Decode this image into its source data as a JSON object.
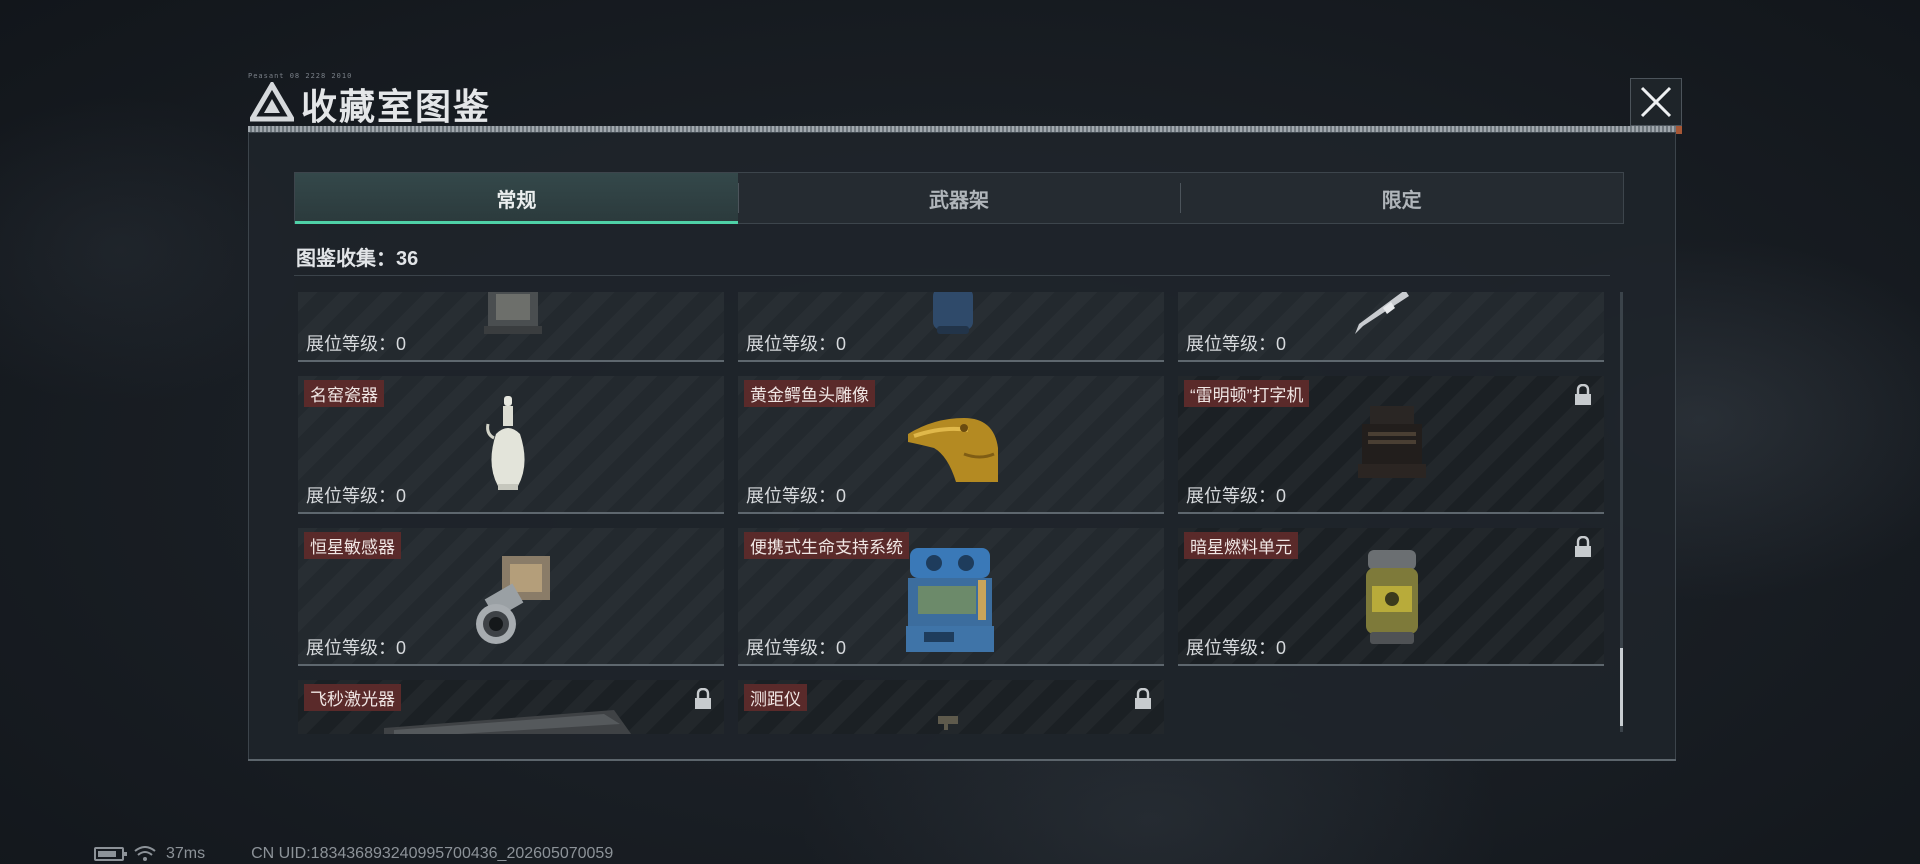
{
  "header": {
    "title": "收藏室图鉴",
    "tiny_text": "Peasant 08 2228 2010",
    "close_icon": "close-icon"
  },
  "tabs": [
    {
      "label": "常规",
      "active": true
    },
    {
      "label": "武器架",
      "active": false
    },
    {
      "label": "限定",
      "active": false
    }
  ],
  "collection": {
    "text": "图鉴收集：36"
  },
  "cards": [
    {
      "name": "",
      "level": "展位等级：0",
      "locked": false,
      "icon": "lantern-icon"
    },
    {
      "name": "",
      "level": "展位等级：0",
      "locked": false,
      "icon": "canister-icon"
    },
    {
      "name": "",
      "level": "展位等级：0",
      "locked": false,
      "icon": "pen-nib-icon"
    },
    {
      "name": "名窑瓷器",
      "level": "展位等级：0",
      "locked": false,
      "icon": "porcelain-vase-icon"
    },
    {
      "name": "黄金鳄鱼头雕像",
      "level": "展位等级：0",
      "locked": false,
      "icon": "golden-crocodile-icon"
    },
    {
      "name": "“雷明顿”打字机",
      "level": "展位等级：0",
      "locked": true,
      "icon": "typewriter-icon"
    },
    {
      "name": "恒星敏感器",
      "level": "展位等级：0",
      "locked": false,
      "icon": "star-sensor-icon"
    },
    {
      "name": "便携式生命支持系统",
      "level": "展位等级：0",
      "locked": false,
      "icon": "life-support-icon"
    },
    {
      "name": "暗星燃料单元",
      "level": "展位等级：0",
      "locked": true,
      "icon": "fuel-cell-icon"
    },
    {
      "name": "飞秒激光器",
      "level": "",
      "locked": true,
      "icon": "laser-icon"
    },
    {
      "name": "测距仪",
      "level": "",
      "locked": true,
      "icon": "rangefinder-icon"
    }
  ],
  "status": {
    "ping": "37ms",
    "uid": "CN UID:183436893240995700436_202605070059"
  },
  "colors": {
    "accent": "#4fd1a7",
    "name_tag": "#5a2a2a",
    "panel": "#1e242a"
  }
}
